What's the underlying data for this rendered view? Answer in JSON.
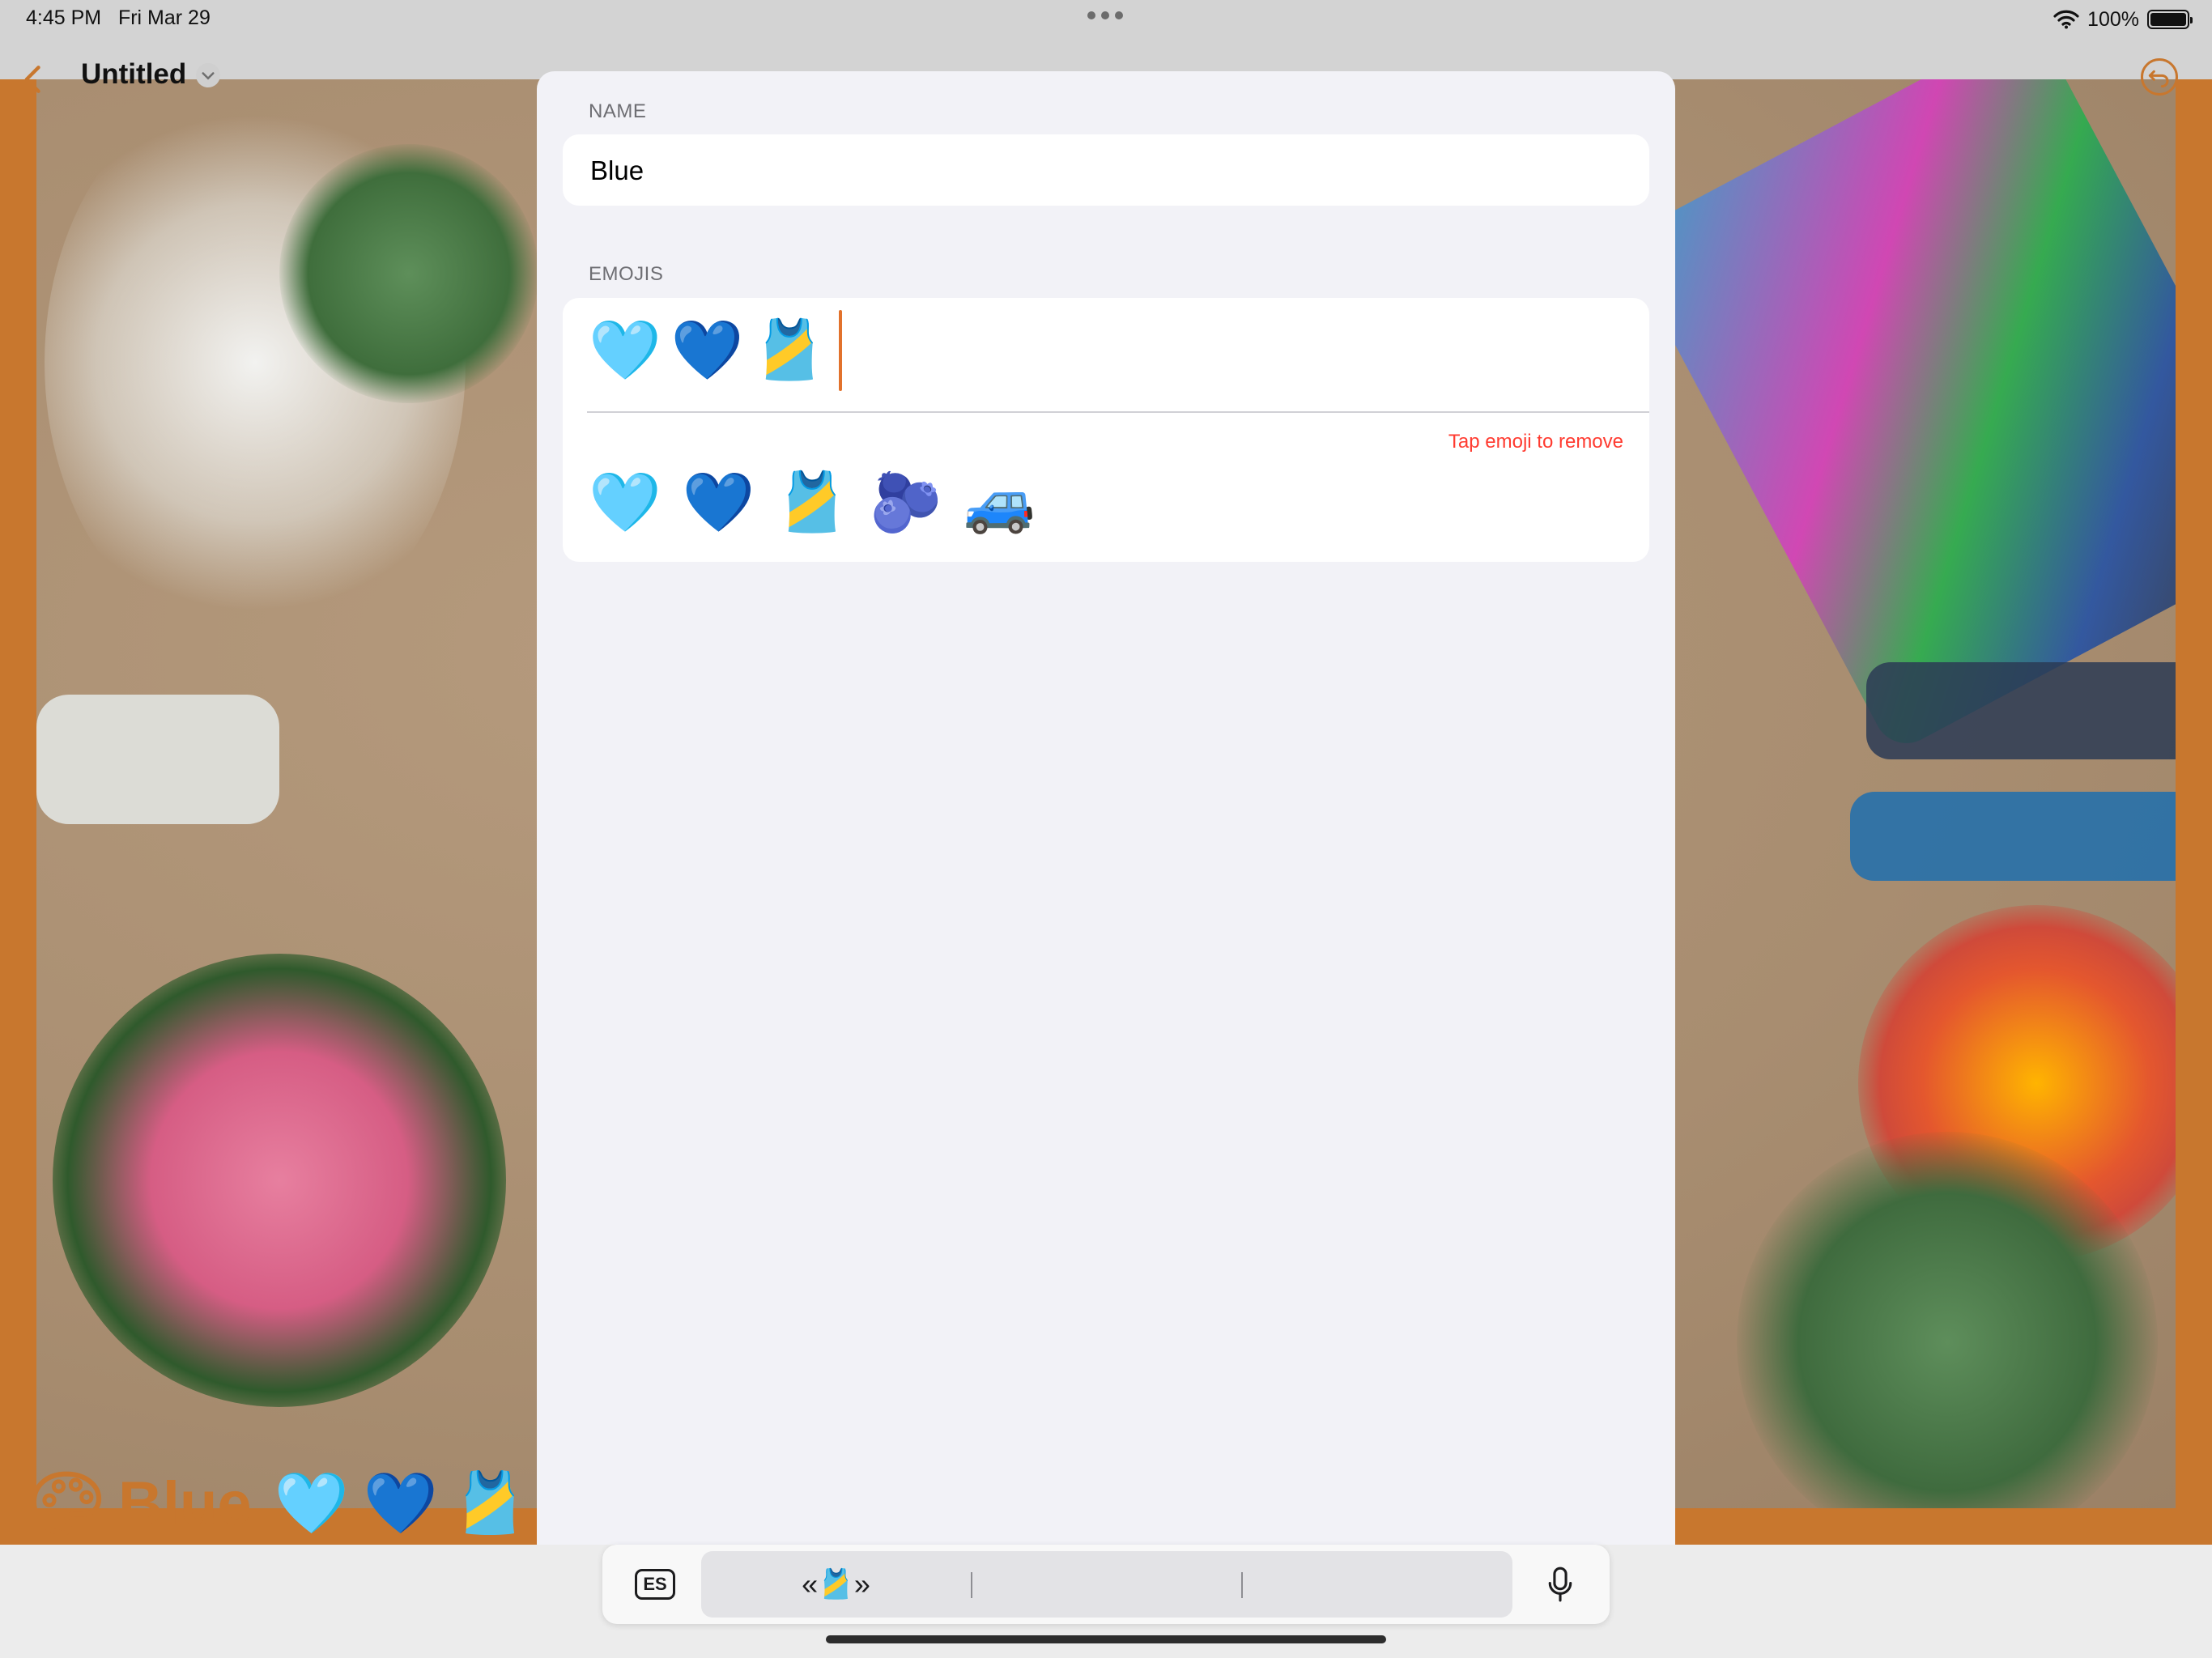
{
  "status_bar": {
    "time": "4:45 PM",
    "date": "Fri Mar 29",
    "battery": "100%"
  },
  "background_app": {
    "title": "Untitled",
    "caption_name": "Blue",
    "caption_emojis": [
      "🩵",
      "💙",
      "🎽"
    ],
    "accent_color": "#c8772e"
  },
  "sheet": {
    "name_section_label": "NAME",
    "name_value": "Blue",
    "emojis_section_label": "EMOJIS",
    "selected_emojis": [
      "🩵",
      "💙",
      "🎽"
    ],
    "remove_hint": "Tap emoji to remove",
    "suggested_emojis": [
      "🩵",
      "💙",
      "🎽",
      "🫐",
      "🚙"
    ]
  },
  "keyboard_bar": {
    "language_key": "ES",
    "prediction": "«🎽»"
  },
  "icons": {
    "back": "chevron-left-icon",
    "undo": "undo-icon",
    "palette": "palette-icon",
    "mic": "microphone-icon",
    "wifi": "wifi-icon",
    "battery": "battery-icon"
  }
}
